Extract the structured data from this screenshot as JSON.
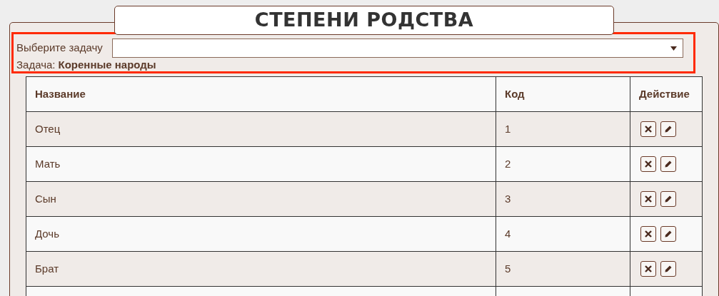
{
  "title": "СТЕПЕНИ РОДСТВА",
  "task_select": {
    "label": "Выберите задачу"
  },
  "task": {
    "label": "Задача:",
    "value": "Коренные народы"
  },
  "table": {
    "columns": [
      "Название",
      "Код",
      "Действие"
    ],
    "rows": [
      {
        "name": "Отец",
        "code": "1"
      },
      {
        "name": "Мать",
        "code": "2"
      },
      {
        "name": "Сын",
        "code": "3"
      },
      {
        "name": "Дочь",
        "code": "4"
      },
      {
        "name": "Брат",
        "code": "5"
      }
    ]
  }
}
